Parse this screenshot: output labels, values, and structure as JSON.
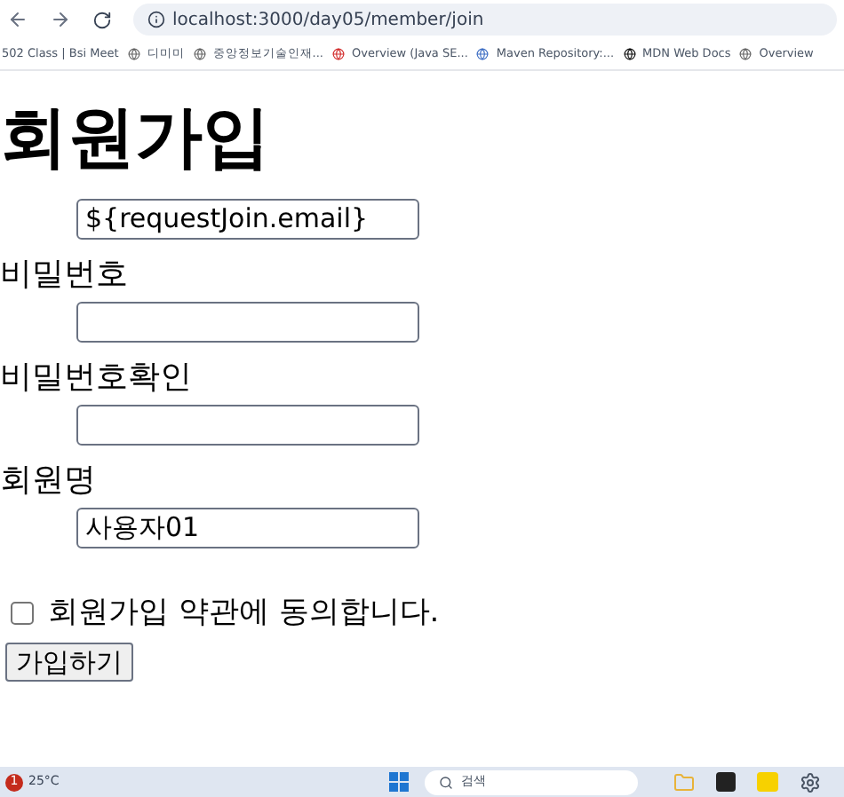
{
  "browser": {
    "url": "localhost:3000/day05/member/join",
    "bookmarks": [
      "502 Class | Bsi Meet",
      "디미미",
      "중앙정보기술인재...",
      "Overview (Java SE...",
      "Maven Repository:...",
      "MDN Web Docs",
      "Overview"
    ]
  },
  "page": {
    "title": "회원가입",
    "fields": [
      {
        "value": "${requestJoin.email}"
      },
      {
        "label": "비밀번호"
      },
      {
        "label": "비밀번호확인"
      },
      {
        "label": "회원명",
        "value": "사용자01"
      }
    ],
    "agree": {
      "label": "회원가입 약관에 동의합니다.",
      "checked": false
    },
    "submit": "가입하기"
  },
  "taskbar": {
    "weather": "25°C",
    "badge": "1",
    "search_placeholder": "검색"
  }
}
